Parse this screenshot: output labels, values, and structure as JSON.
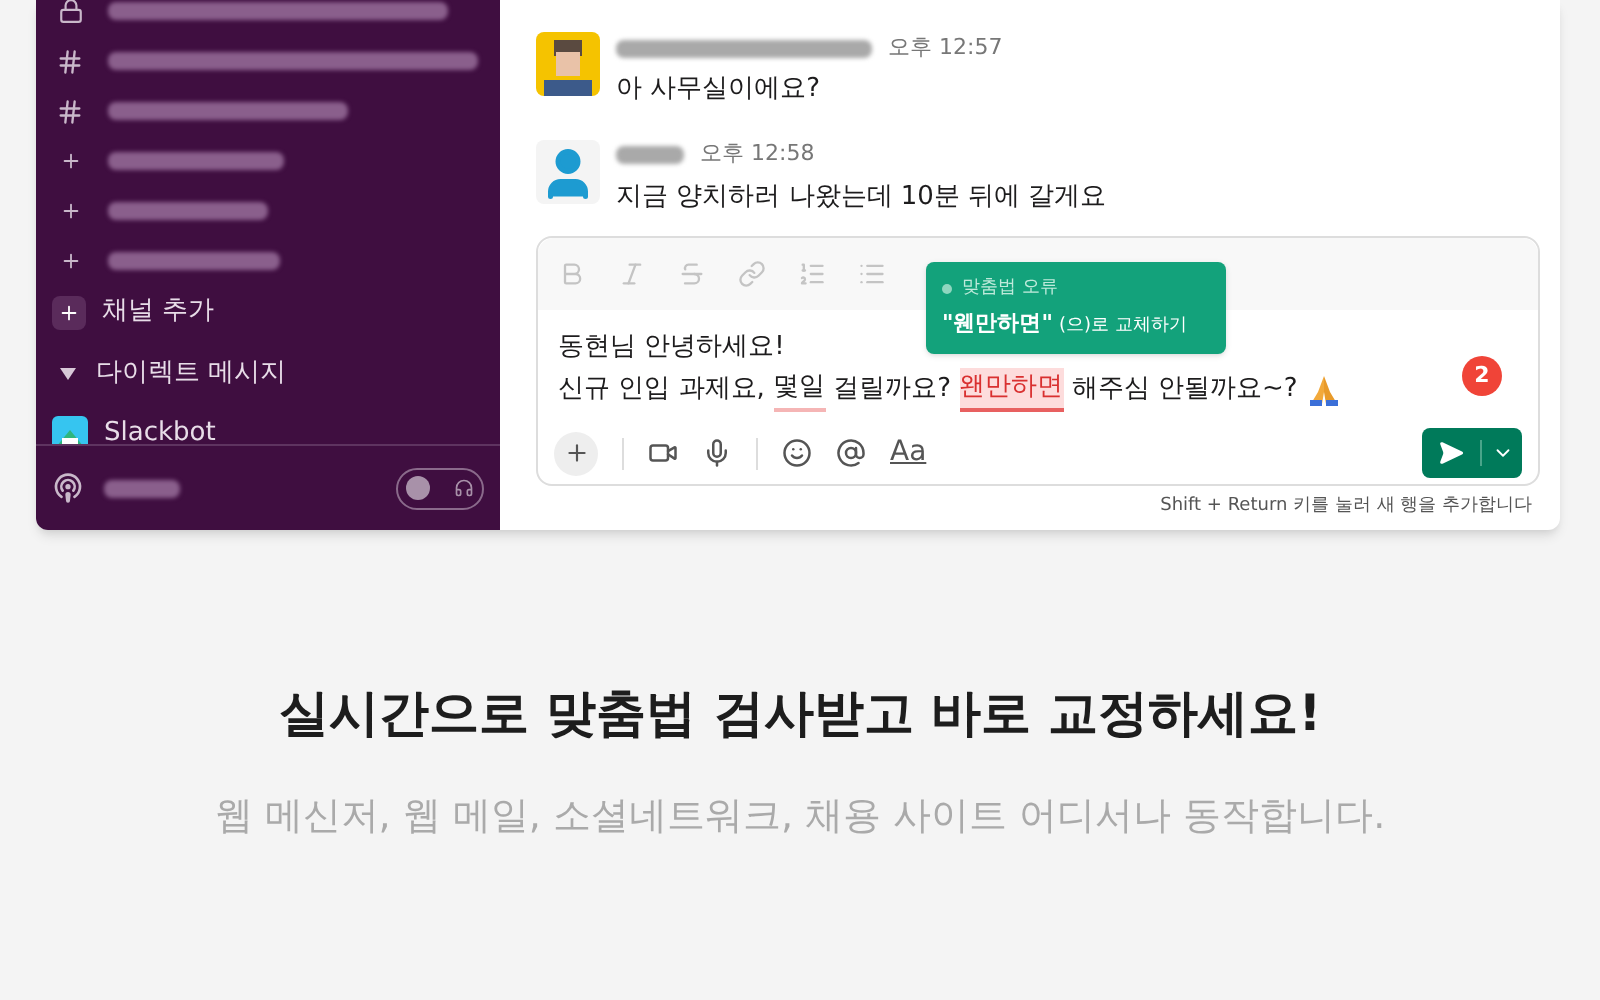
{
  "sidebar": {
    "channels": [
      {
        "kind": "lock"
      },
      {
        "kind": "hash"
      },
      {
        "kind": "hash"
      },
      {
        "kind": "plus"
      },
      {
        "kind": "plus"
      },
      {
        "kind": "plus"
      }
    ],
    "add_channel": "채널 추가",
    "dm_header": "다이렉트 메시지",
    "dms": [
      {
        "name": "Slackbot"
      }
    ]
  },
  "footer": {
    "huddle_on": false
  },
  "messages": [
    {
      "time": "오후 12:57",
      "text": "아 사무실이에요?"
    },
    {
      "kind": "person",
      "time": "오후 12:58",
      "text": "지금 양치하러 나왔는데 10분 뒤에 갈게요"
    }
  ],
  "composer": {
    "line_1": "동현님 안녕하세요!",
    "line_2": [
      {
        "kind": "plain",
        "text": "신규 인입 과제요, "
      },
      {
        "kind": "underline",
        "text": "몇일"
      },
      {
        "kind": "plain",
        "text": " 걸릴까요? "
      },
      {
        "kind": "highlight",
        "text": "왠만하면"
      },
      {
        "kind": "plain",
        "text": " 해주심 안될까요~? "
      }
    ],
    "tooltip": {
      "category": "맞춤법 오류",
      "suggestion": "\"웬만하면\"",
      "action": "(으)로 교체하기"
    },
    "error_count": "2",
    "format_button": "Aa",
    "hint": "Shift + Return 키를 눌러 새 행을 추가합니다"
  },
  "headline": "실시간으로 맞춤법 검사받고 바로 교정하세요!",
  "subtitle": "웹 메신저, 웹 메일, 소셜네트워크, 채용 사이트 어디서나 동작합니다."
}
